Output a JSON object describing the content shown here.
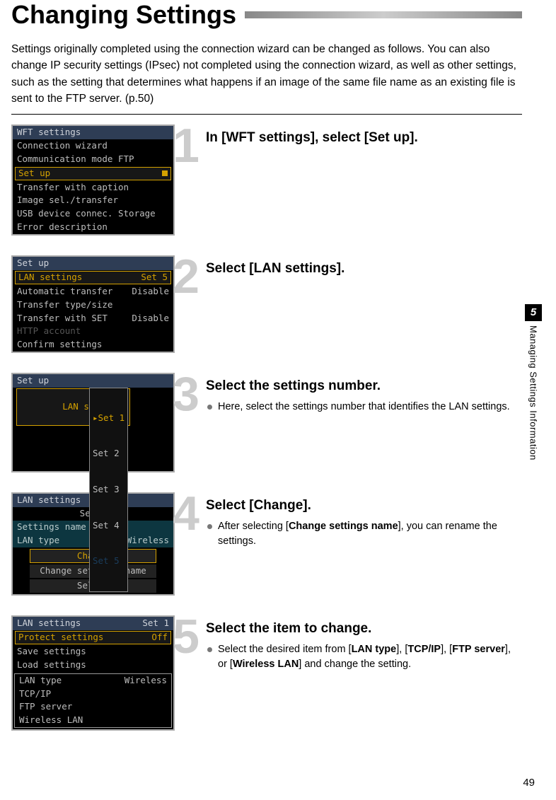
{
  "title": "Changing Settings",
  "intro": "Settings originally completed using the connection wizard can be changed as follows. You can also change IP security settings (IPsec) not completed using the connection wizard, as well as other settings, such as the setting that determines what happens if an image of the same file name as an existing file is sent to the FTP server. (p.50)",
  "steps": [
    {
      "n": "1",
      "title": "In [WFT settings], select [Set up].",
      "bullets": [],
      "shot": {
        "header": "WFT settings",
        "rows": [
          "Connection wizard",
          "Communication mode FTP"
        ],
        "hl": "Set up",
        "rows2": [
          "Transfer with caption",
          "Image sel./transfer",
          "USB device connec. Storage",
          "Error description"
        ]
      }
    },
    {
      "n": "2",
      "title": "Select [LAN settings].",
      "bullets": [],
      "shot": {
        "header": "Set up",
        "hlrow": {
          "l": "LAN settings",
          "r": "Set 5"
        },
        "rows": [
          {
            "l": "Automatic transfer",
            "r": "Disable"
          },
          {
            "l": "Transfer type/size",
            "r": ""
          },
          {
            "l": "Transfer with SET",
            "r": "Disable"
          }
        ],
        "dim": "HTTP account",
        "rows2": [
          "Confirm settings"
        ]
      }
    },
    {
      "n": "3",
      "title": "Select the settings number.",
      "bullets": [
        "Here, select the settings number that identifies the LAN settings."
      ],
      "shot": {
        "header": "Set up",
        "label": "LAN settings",
        "opts": [
          "▸Set 1",
          " Set 2",
          " Set 3",
          " Set 4"
        ],
        "optdim": " Set 5"
      }
    },
    {
      "n": "4",
      "title": "Select [Change].",
      "bullets": [
        "After selecting [Change settings name], you can rename the settings."
      ],
      "bold_terms": [
        "Change settings name"
      ],
      "shot": {
        "header": "LAN settings",
        "sub": "Set 1",
        "teal": [
          {
            "l": "Settings name",
            "r": ""
          },
          {
            "l": "LAN type",
            "r": "Wireless"
          }
        ],
        "pills": [
          "Change",
          "Change settings name",
          "Select"
        ]
      }
    },
    {
      "n": "5",
      "title": "Select the item to change.",
      "bullets": [
        "Select the desired item from [LAN type], [TCP/IP], [FTP server], or [Wireless LAN] and change the setting."
      ],
      "bold_terms": [
        "LAN type",
        "TCP/IP",
        "FTP server",
        "Wireless LAN"
      ],
      "shot": {
        "header": {
          "l": "LAN settings",
          "r": "Set 1"
        },
        "hlrow": {
          "l": "Protect settings",
          "r": "Off"
        },
        "rows": [
          "Save settings",
          "Load settings"
        ],
        "box": [
          {
            "l": "LAN type",
            "r": "Wireless"
          },
          {
            "l": "TCP/IP",
            "r": ""
          },
          {
            "l": "FTP server",
            "r": ""
          },
          {
            "l": "Wireless LAN",
            "r": ""
          }
        ]
      }
    }
  ],
  "side": {
    "num": "5",
    "label": "Managing Settings Information"
  },
  "pagenum": "49"
}
